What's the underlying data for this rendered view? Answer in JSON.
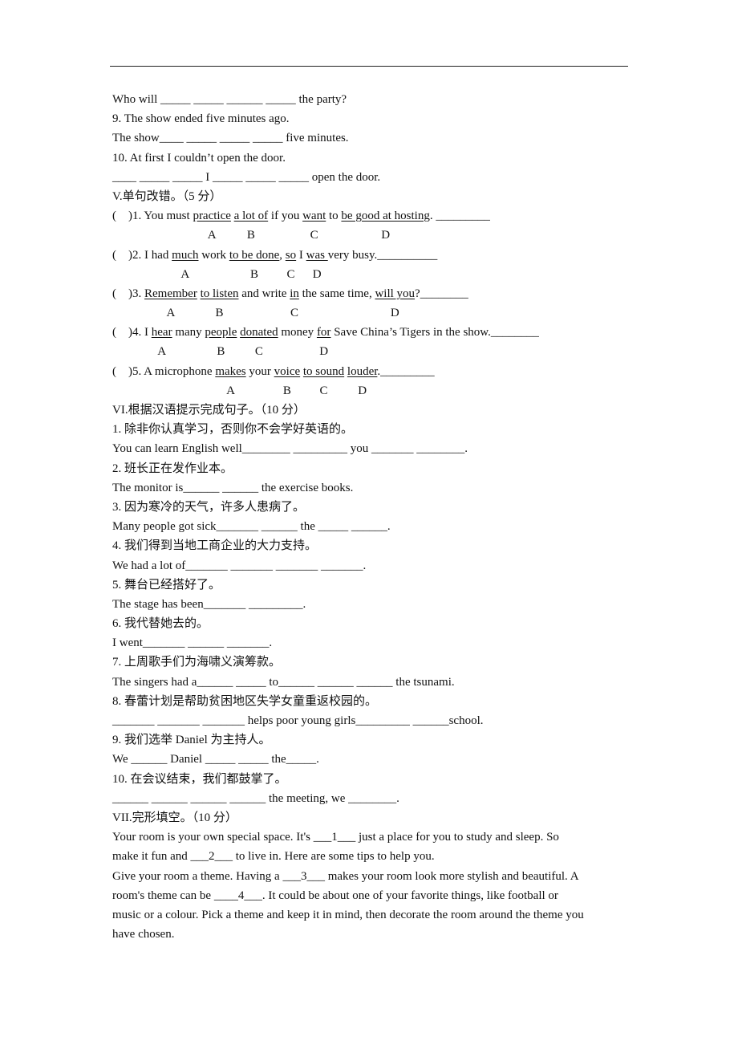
{
  "header_rule": true,
  "part4_tail": [
    "Who will _____ _____ ______ _____ the party?",
    "9. The show ended five minutes ago.",
    "The show____ _____ _____ _____ five minutes.",
    "10. At first I couldn’t open the door.",
    "____ _____ _____ I _____ _____ _____ open the door."
  ],
  "part5": {
    "heading": "V.单句改错。（5 分）",
    "items": [
      {
        "prefix": "(    )1. You must ",
        "segments": [
          {
            "t": "practice",
            "u": true
          },
          {
            "t": " ",
            "u": false
          },
          {
            "t": "a lot of",
            "u": true
          },
          {
            "t": " if you ",
            "u": false
          },
          {
            "t": "want",
            "u": true
          },
          {
            "t": " to ",
            "u": false
          },
          {
            "t": "be good at hosting",
            "u": true
          },
          {
            "t": ". _________",
            "u": false
          }
        ],
        "options": [
          "A",
          "B",
          "C",
          "D"
        ]
      },
      {
        "prefix": "(    )2. I had ",
        "segments": [
          {
            "t": "much",
            "u": true
          },
          {
            "t": " work ",
            "u": false
          },
          {
            "t": "to be done",
            "u": true
          },
          {
            "t": ", ",
            "u": false
          },
          {
            "t": "so",
            "u": true
          },
          {
            "t": " I ",
            "u": false
          },
          {
            "t": "was ",
            "u": true
          },
          {
            "t": "very busy.__________",
            "u": false
          }
        ],
        "options": [
          "A",
          "B",
          "C",
          "D"
        ]
      },
      {
        "prefix": "(    )3. ",
        "segments": [
          {
            "t": "Remember",
            "u": true
          },
          {
            "t": " ",
            "u": false
          },
          {
            "t": "to listen",
            "u": true
          },
          {
            "t": " and write ",
            "u": false
          },
          {
            "t": "in",
            "u": true
          },
          {
            "t": " the same time, ",
            "u": false
          },
          {
            "t": "will you",
            "u": true
          },
          {
            "t": "?________",
            "u": false
          }
        ],
        "options": [
          "A",
          "B",
          "C",
          "D"
        ]
      },
      {
        "prefix": "(    )4. I ",
        "segments": [
          {
            "t": "hear",
            "u": true
          },
          {
            "t": " many ",
            "u": false
          },
          {
            "t": "people",
            "u": true
          },
          {
            "t": " ",
            "u": false
          },
          {
            "t": "donated",
            "u": true
          },
          {
            "t": " money ",
            "u": false
          },
          {
            "t": "for",
            "u": true
          },
          {
            "t": " Save China’s Tigers in the show.________",
            "u": false
          }
        ],
        "options": [
          "A",
          "B",
          "C",
          "D"
        ]
      },
      {
        "prefix": "(    )5. A microphone ",
        "segments": [
          {
            "t": "makes",
            "u": true
          },
          {
            "t": " your ",
            "u": false
          },
          {
            "t": "voice",
            "u": true
          },
          {
            "t": " ",
            "u": false
          },
          {
            "t": "to sound",
            "u": true
          },
          {
            "t": " ",
            "u": false
          },
          {
            "t": "louder",
            "u": true
          },
          {
            "t": "._________",
            "u": false
          }
        ],
        "options": [
          "A",
          "B",
          "C",
          "D"
        ]
      }
    ]
  },
  "part6": {
    "heading": "VI.根据汉语提示完成句子。（10 分）",
    "items": [
      {
        "cn": "1. 除非你认真学习，否则你不会学好英语的。",
        "en": "You can learn English well________ _________ you _______ ________."
      },
      {
        "cn": "2. 班长正在发作业本。",
        "en": "The monitor is______ ______ the exercise books."
      },
      {
        "cn": "3. 因为寒冷的天气，许多人患病了。",
        "en": "Many people got sick_______ ______ the _____ ______."
      },
      {
        "cn": "4. 我们得到当地工商企业的大力支持。",
        "en": "We had a lot of_______ _______ _______ _______."
      },
      {
        "cn": "5. 舞台已经搭好了。",
        "en": "The stage has been_______ _________."
      },
      {
        "cn": "6. 我代替她去的。",
        "en": "I went_______ ______ _______."
      },
      {
        "cn": "7. 上周歌手们为海啸义演筹款。",
        "en": "The singers had a______ _____ to______ ______ ______ the tsunami."
      },
      {
        "cn": "8. 春蕾计划是帮助贫困地区失学女童重返校园的。",
        "en": "_______ _______ _______ helps poor young girls_________ ______school."
      },
      {
        "cn": "9. 我们选举 Daniel 为主持人。",
        "en": "We ______ Daniel _____ _____ the_____."
      },
      {
        "cn": "10. 在会议结束，我们都鼓掌了。",
        "en": "______ ______ ______ ______ the meeting, we ________."
      }
    ]
  },
  "part7": {
    "heading": "VII.完形填空。（10 分）",
    "lines": [
      "Your room is your own special space. It's ___1___ just a place for you to study and sleep. So",
      "make it fun and ___2___ to live in. Here are some tips to help you.",
      "Give your room a theme. Having a ___3___ makes your room look more stylish and beautiful. A",
      "room's theme can be ____4___. It could be about one of your favorite things, like football or",
      "music or a colour. Pick a theme and keep it in mind, then decorate the room around the theme you",
      "have chosen."
    ]
  }
}
